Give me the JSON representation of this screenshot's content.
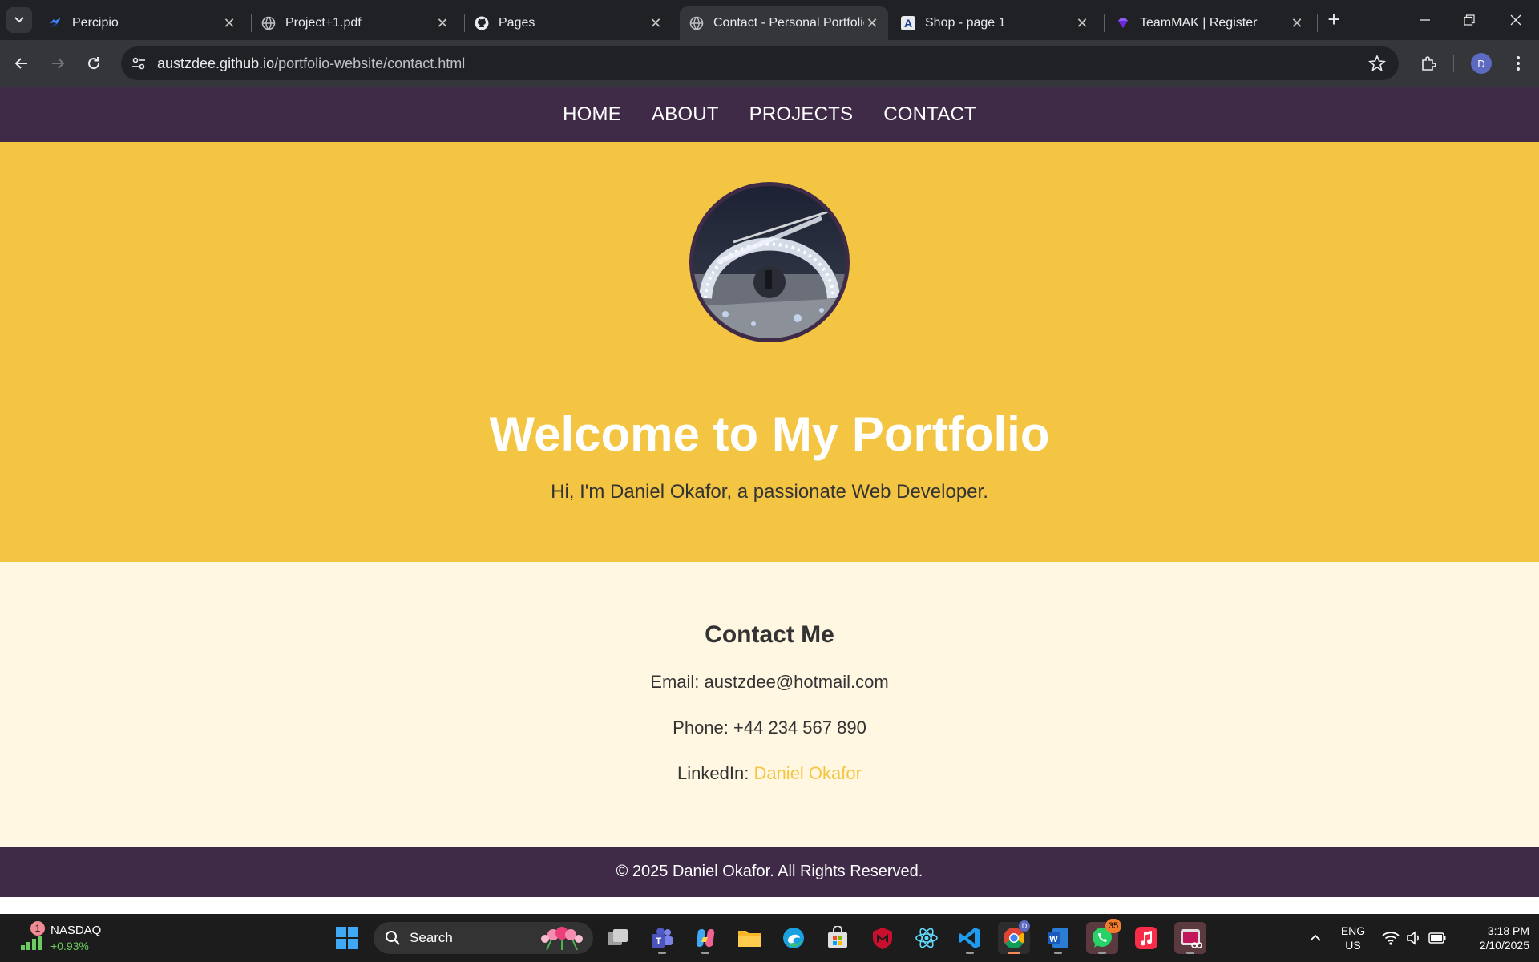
{
  "browser": {
    "tabs": [
      {
        "title": "Percipio",
        "favicon": "percipio-icon",
        "active": false
      },
      {
        "title": "Project+1.pdf",
        "favicon": "globe-icon",
        "active": false
      },
      {
        "title": "Pages",
        "favicon": "github-icon",
        "active": false
      },
      {
        "title": "Contact - Personal Portfolio",
        "favicon": "globe-icon",
        "active": true
      },
      {
        "title": "Shop - page 1",
        "favicon": "letter-a-icon",
        "active": false
      },
      {
        "title": "TeamMAK | Register",
        "favicon": "gem-icon",
        "active": false
      }
    ],
    "url_host": "austzdee.github.io",
    "url_path": "/portfolio-website/contact.html",
    "profile_initial": "D"
  },
  "site": {
    "nav": [
      "HOME",
      "ABOUT",
      "PROJECTS",
      "CONTACT"
    ],
    "hero": {
      "title": "Welcome to My Portfolio",
      "subtitle": "Hi, I'm Daniel Okafor, a passionate Web Developer."
    },
    "contact": {
      "heading": "Contact Me",
      "email_label": "Email:",
      "email": "austzdee@hotmail.com",
      "phone_label": "Phone:",
      "phone": "+44 234 567 890",
      "linkedin_label": "LinkedIn:",
      "linkedin_link": "Daniel Okafor"
    },
    "footer": "© 2025 Daniel Okafor. All Rights Reserved.",
    "colors": {
      "nav_bg": "#3f2a47",
      "hero_bg": "#f4c542",
      "contact_bg": "#fff7e1",
      "link": "#f4c542"
    }
  },
  "taskbar": {
    "stock_name": "NASDAQ",
    "stock_change": "+0.93%",
    "stock_badge": "1",
    "search_label": "Search",
    "whatsapp_badge": "35",
    "chrome_badge": "D",
    "lang_1": "ENG",
    "lang_2": "US",
    "time": "3:18 PM",
    "date": "2/10/2025"
  }
}
